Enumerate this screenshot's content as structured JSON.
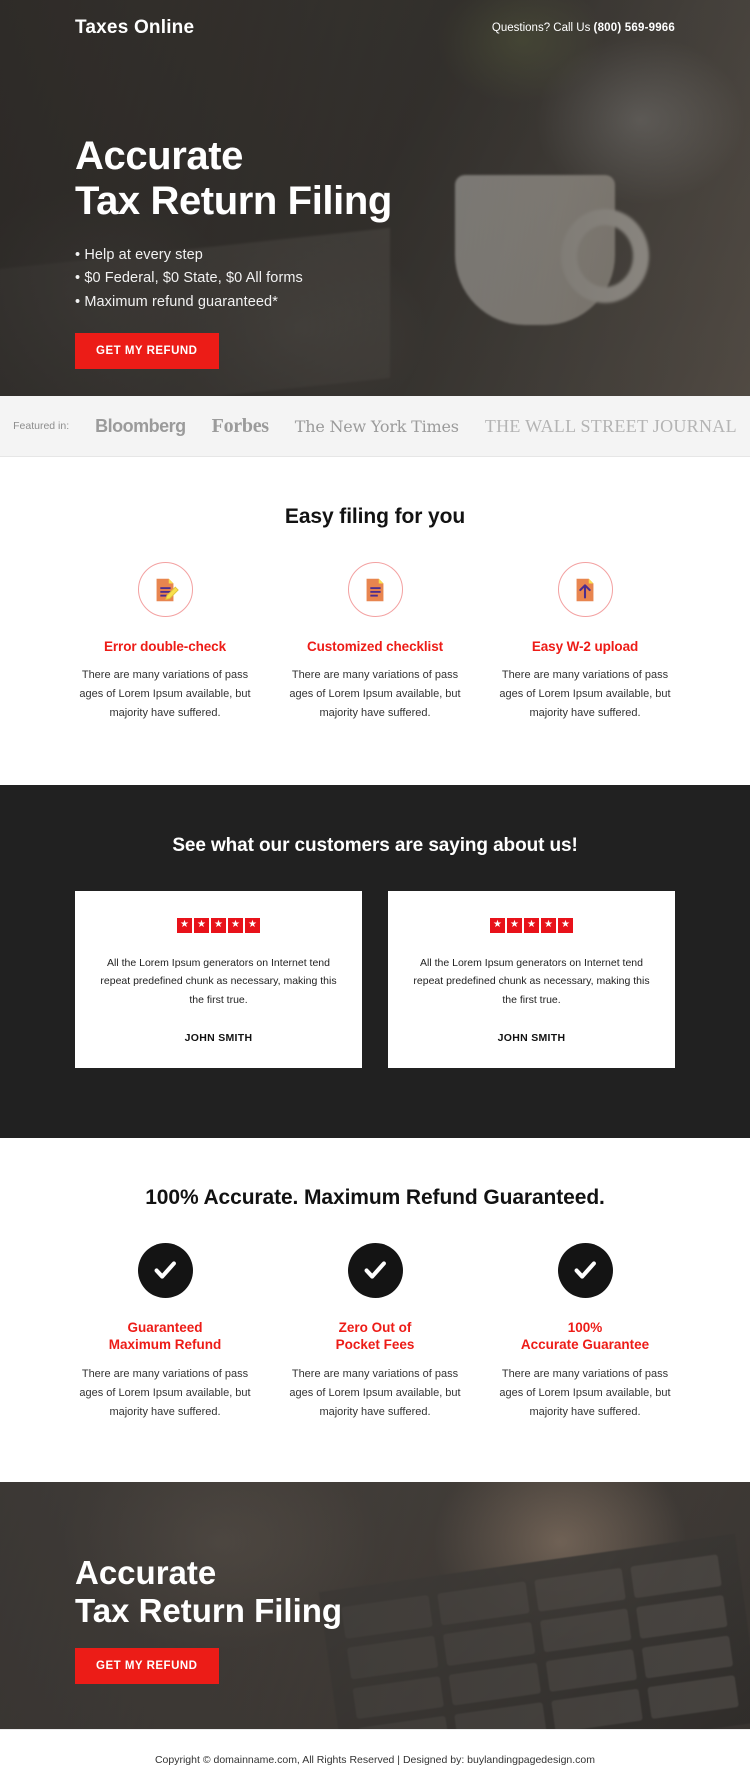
{
  "hero": {
    "brand": "Taxes Online",
    "phone_label": "Questions? Call Us ",
    "phone_number": "(800) 569-9966",
    "title_line1": "Accurate",
    "title_line2": "Tax Return Filing",
    "bullets": [
      "Help at every step",
      "$0 Federal, $0 State, $0 All forms",
      "Maximum refund guaranteed*"
    ],
    "cta_label": "GET MY REFUND"
  },
  "featured": {
    "label": "Featured in:",
    "logos": [
      "Bloomberg",
      "Forbes",
      "The New York Times",
      "THE WALL STREET JOURNAL"
    ]
  },
  "features": {
    "title": "Easy filing for you",
    "items": [
      {
        "icon": "document-pencil-icon",
        "name": "Error double-check",
        "text": "There are many variations of pass ages of Lorem Ipsum available, but majority have suffered."
      },
      {
        "icon": "document-lines-icon",
        "name": "Customized checklist",
        "text": "There are many variations of pass ages of Lorem Ipsum available, but majority have suffered."
      },
      {
        "icon": "document-upload-arrow-icon",
        "name": "Easy W-2 upload",
        "text": "There are many variations of pass ages of Lorem Ipsum available, but majority have suffered."
      }
    ]
  },
  "testimonials": {
    "title": "See what our customers are saying about us!",
    "star_glyph": "★",
    "star_count": 5,
    "cards": [
      {
        "quote": "All the Lorem Ipsum generators on Internet tend repeat predefined chunk as necessary, making this the first true.",
        "author": "JOHN SMITH"
      },
      {
        "quote": "All the Lorem Ipsum generators on Internet tend repeat predefined chunk as necessary, making this the first true.",
        "author": "JOHN SMITH"
      }
    ]
  },
  "guarantees": {
    "title": "100% Accurate. Maximum Refund Guaranteed.",
    "check_glyph": "✔",
    "items": [
      {
        "name_line1": "Guaranteed",
        "name_line2": "Maximum Refund",
        "text": "There are many variations of pass ages of Lorem Ipsum available, but majority have suffered."
      },
      {
        "name_line1": "Zero Out of",
        "name_line2": "Pocket Fees",
        "text": "There are many variations of pass ages of Lorem Ipsum available, but majority have suffered."
      },
      {
        "name_line1": "100%",
        "name_line2": "Accurate Guarantee",
        "text": "There are many variations of pass ages of Lorem Ipsum available, but majority have suffered."
      }
    ]
  },
  "hero_bottom": {
    "title_line1": "Accurate",
    "title_line2": "Tax Return Filing",
    "cta_label": "GET MY REFUND"
  },
  "footer": {
    "text": "Copyright © domainname.com, All Rights Reserved  |  Designed by: buylandingpagedesign.com"
  },
  "colors": {
    "accent_red": "#ec1c17",
    "dark": "#212121",
    "featured_bg": "#f4f4f4"
  }
}
